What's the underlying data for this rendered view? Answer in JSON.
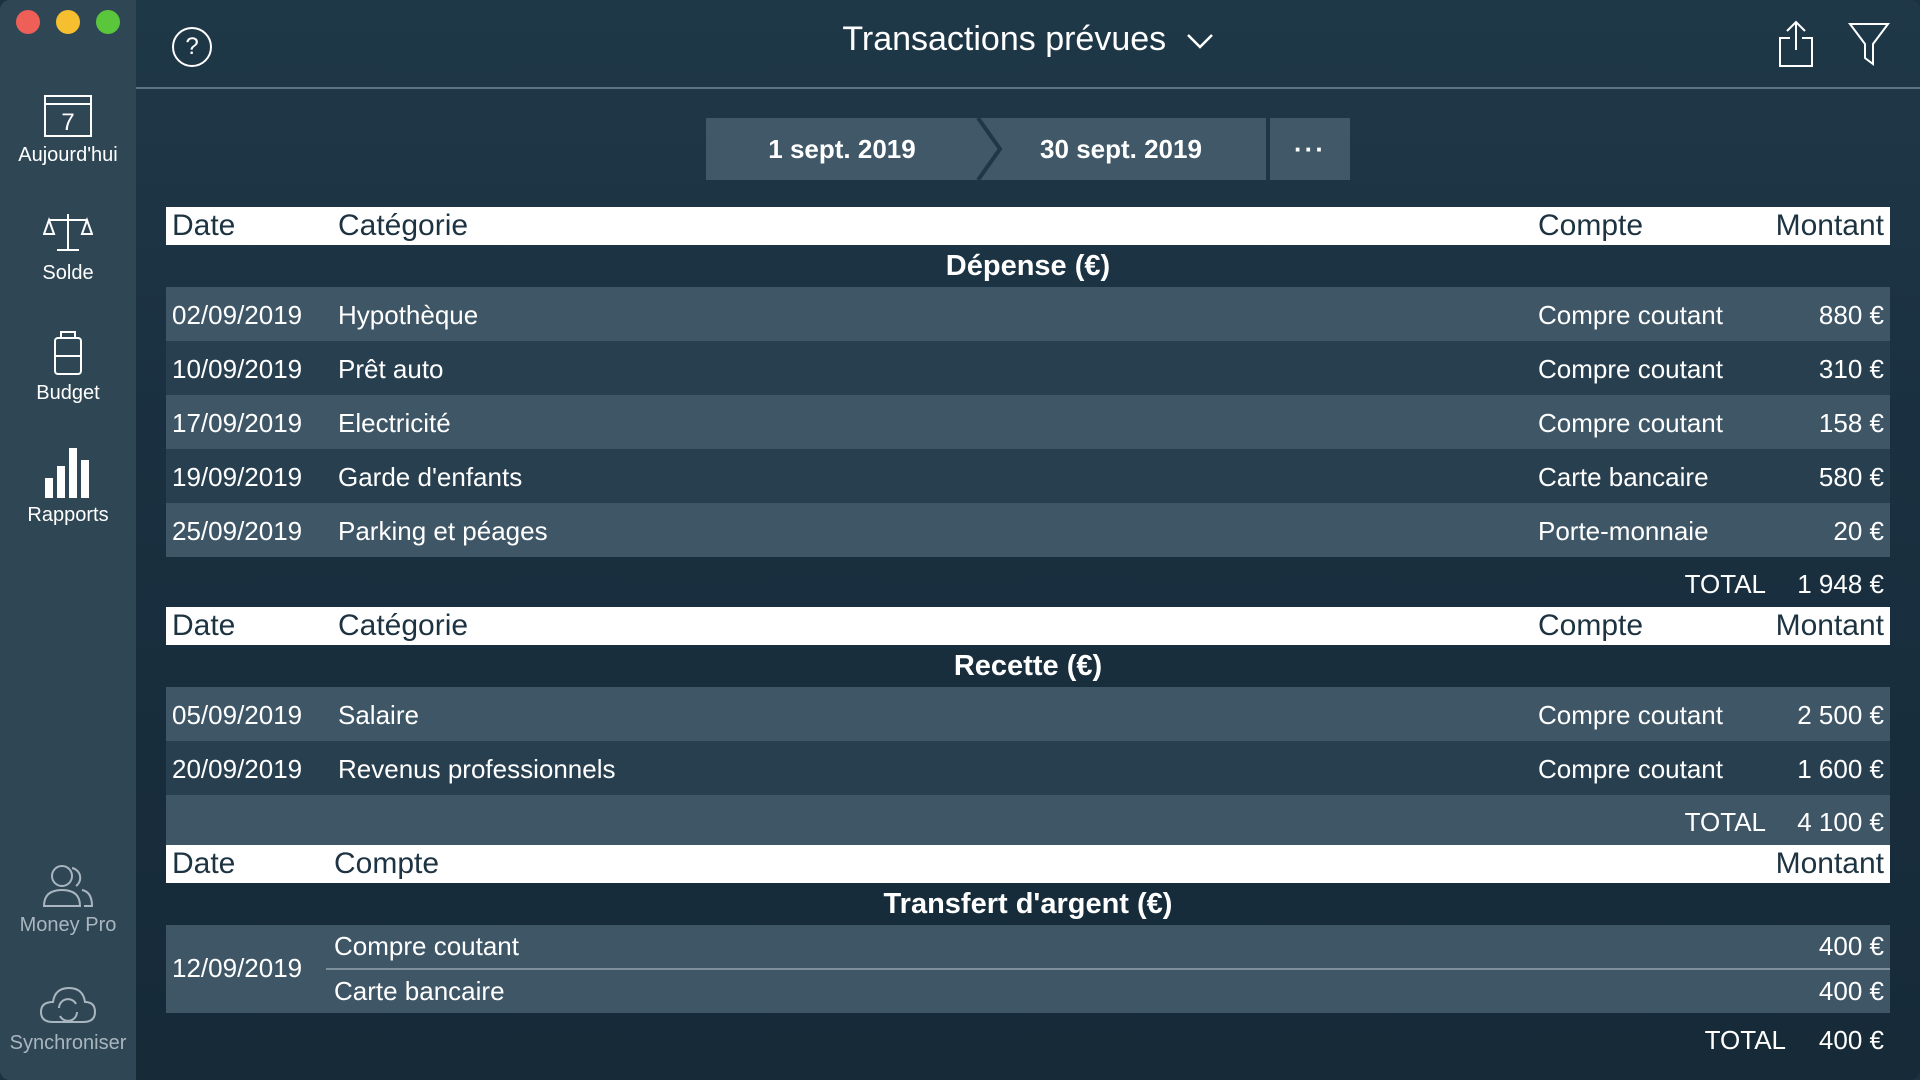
{
  "window": {
    "title": "Transactions prévues"
  },
  "sidebar": {
    "items": [
      {
        "label": "Aujourd'hui",
        "icon": "calendar-icon",
        "icon_text": "7"
      },
      {
        "label": "Solde",
        "icon": "balance-scale-icon"
      },
      {
        "label": "Budget",
        "icon": "budget-jar-icon"
      },
      {
        "label": "Rapports",
        "icon": "bar-chart-icon"
      }
    ],
    "bottom": [
      {
        "label": "Money Pro",
        "icon": "users-icon"
      },
      {
        "label": "Synchroniser",
        "icon": "cloud-sync-icon"
      }
    ]
  },
  "toolbar": {
    "help": "?",
    "share_icon": "share-icon",
    "filter_icon": "filter-icon"
  },
  "date_range": {
    "start": "1 sept. 2019",
    "end": "30 sept. 2019",
    "more": "···"
  },
  "headers": {
    "date": "Date",
    "category": "Catégorie",
    "account": "Compte",
    "amount": "Montant"
  },
  "expenses": {
    "title": "Dépense (€)",
    "rows": [
      {
        "date": "02/09/2019",
        "category": "Hypothèque",
        "account": "Compre coutant",
        "amount": "880 €"
      },
      {
        "date": "10/09/2019",
        "category": "Prêt auto",
        "account": "Compre coutant",
        "amount": "310 €"
      },
      {
        "date": "17/09/2019",
        "category": "Electricité",
        "account": "Compre coutant",
        "amount": "158 €"
      },
      {
        "date": "19/09/2019",
        "category": "Garde d'enfants",
        "account": "Carte bancaire",
        "amount": "580 €"
      },
      {
        "date": "25/09/2019",
        "category": "Parking et péages",
        "account": "Porte-monnaie",
        "amount": "20 €"
      }
    ],
    "total_label": "TOTAL",
    "total": "1 948 €"
  },
  "income": {
    "title": "Recette (€)",
    "rows": [
      {
        "date": "05/09/2019",
        "category": "Salaire",
        "account": "Compre coutant",
        "amount": "2 500 €"
      },
      {
        "date": "20/09/2019",
        "category": "Revenus professionnels",
        "account": "Compre coutant",
        "amount": "1 600 €"
      }
    ],
    "total_label": "TOTAL",
    "total": "4 100 €"
  },
  "transfers": {
    "title": "Transfert d'argent (€)",
    "rows": [
      {
        "date": "12/09/2019",
        "from_account": "Compre coutant",
        "from_amount": "400 €",
        "to_account": "Carte bancaire",
        "to_amount": "400 €"
      }
    ],
    "total_label": "TOTAL",
    "total": "400 €"
  }
}
